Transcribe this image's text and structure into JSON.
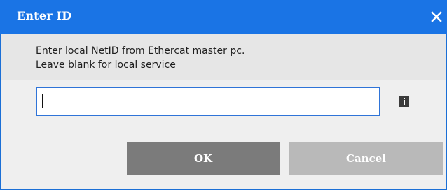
{
  "dialog": {
    "title": "Enter ID",
    "message_lines": [
      "Enter local NetID from Ethercat master pc.",
      "Leave blank for local service"
    ],
    "input_value": "",
    "input_placeholder": "",
    "buttons": {
      "ok_label": "OK",
      "cancel_label": "Cancel"
    }
  },
  "icons": {
    "close": "close-icon",
    "info": "info-icon"
  },
  "colors": {
    "titlebar": "#1a74e5",
    "input_border": "#2f74d8",
    "ok_button": "#7b7b7b",
    "cancel_button": "#b9b9b9"
  }
}
